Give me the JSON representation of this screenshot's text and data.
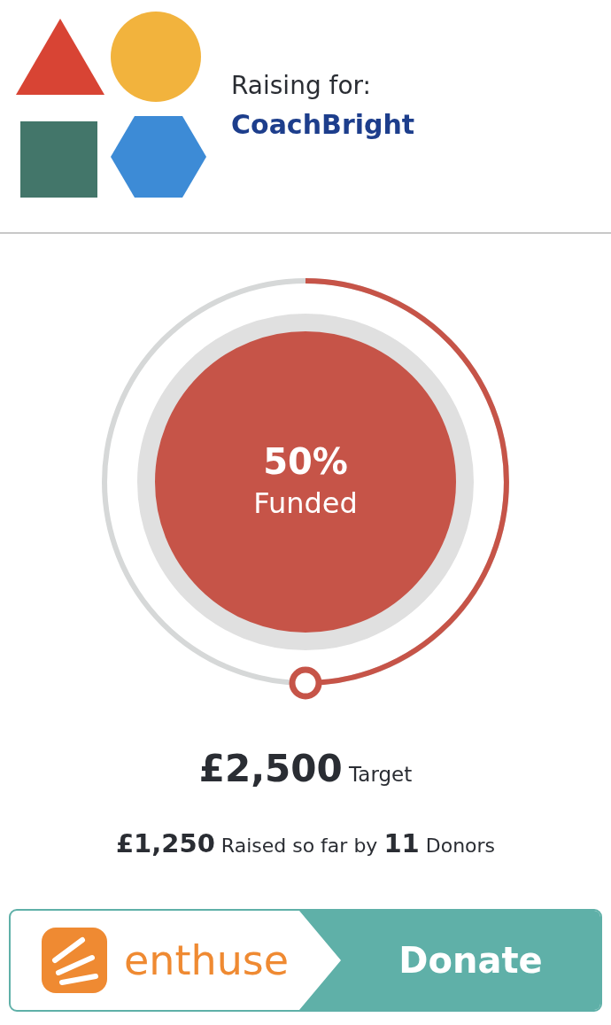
{
  "header": {
    "label": "Raising for:",
    "organisation": "CoachBright"
  },
  "progress": {
    "level": 0.5,
    "percent": "50%",
    "caption": "Funded"
  },
  "target": "**£2,500** Target",
  "raised": "**£1,250** Raised so far by **11** Donors",
  "donate": {
    "brand": "enthuse",
    "button": "Donate"
  }
}
